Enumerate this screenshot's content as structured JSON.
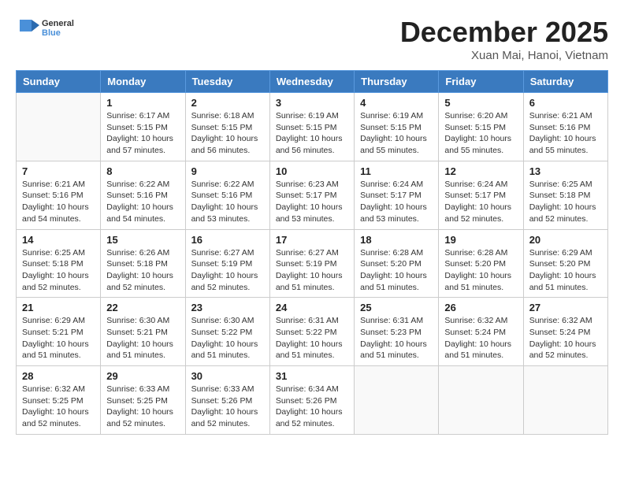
{
  "header": {
    "logo_general": "General",
    "logo_blue": "Blue",
    "month_year": "December 2025",
    "location": "Xuan Mai, Hanoi, Vietnam"
  },
  "weekdays": [
    "Sunday",
    "Monday",
    "Tuesday",
    "Wednesday",
    "Thursday",
    "Friday",
    "Saturday"
  ],
  "weeks": [
    [
      {
        "day": "",
        "info": ""
      },
      {
        "day": "1",
        "info": "Sunrise: 6:17 AM\nSunset: 5:15 PM\nDaylight: 10 hours\nand 57 minutes."
      },
      {
        "day": "2",
        "info": "Sunrise: 6:18 AM\nSunset: 5:15 PM\nDaylight: 10 hours\nand 56 minutes."
      },
      {
        "day": "3",
        "info": "Sunrise: 6:19 AM\nSunset: 5:15 PM\nDaylight: 10 hours\nand 56 minutes."
      },
      {
        "day": "4",
        "info": "Sunrise: 6:19 AM\nSunset: 5:15 PM\nDaylight: 10 hours\nand 55 minutes."
      },
      {
        "day": "5",
        "info": "Sunrise: 6:20 AM\nSunset: 5:15 PM\nDaylight: 10 hours\nand 55 minutes."
      },
      {
        "day": "6",
        "info": "Sunrise: 6:21 AM\nSunset: 5:16 PM\nDaylight: 10 hours\nand 55 minutes."
      }
    ],
    [
      {
        "day": "7",
        "info": "Sunrise: 6:21 AM\nSunset: 5:16 PM\nDaylight: 10 hours\nand 54 minutes."
      },
      {
        "day": "8",
        "info": "Sunrise: 6:22 AM\nSunset: 5:16 PM\nDaylight: 10 hours\nand 54 minutes."
      },
      {
        "day": "9",
        "info": "Sunrise: 6:22 AM\nSunset: 5:16 PM\nDaylight: 10 hours\nand 53 minutes."
      },
      {
        "day": "10",
        "info": "Sunrise: 6:23 AM\nSunset: 5:17 PM\nDaylight: 10 hours\nand 53 minutes."
      },
      {
        "day": "11",
        "info": "Sunrise: 6:24 AM\nSunset: 5:17 PM\nDaylight: 10 hours\nand 53 minutes."
      },
      {
        "day": "12",
        "info": "Sunrise: 6:24 AM\nSunset: 5:17 PM\nDaylight: 10 hours\nand 52 minutes."
      },
      {
        "day": "13",
        "info": "Sunrise: 6:25 AM\nSunset: 5:18 PM\nDaylight: 10 hours\nand 52 minutes."
      }
    ],
    [
      {
        "day": "14",
        "info": "Sunrise: 6:25 AM\nSunset: 5:18 PM\nDaylight: 10 hours\nand 52 minutes."
      },
      {
        "day": "15",
        "info": "Sunrise: 6:26 AM\nSunset: 5:18 PM\nDaylight: 10 hours\nand 52 minutes."
      },
      {
        "day": "16",
        "info": "Sunrise: 6:27 AM\nSunset: 5:19 PM\nDaylight: 10 hours\nand 52 minutes."
      },
      {
        "day": "17",
        "info": "Sunrise: 6:27 AM\nSunset: 5:19 PM\nDaylight: 10 hours\nand 51 minutes."
      },
      {
        "day": "18",
        "info": "Sunrise: 6:28 AM\nSunset: 5:20 PM\nDaylight: 10 hours\nand 51 minutes."
      },
      {
        "day": "19",
        "info": "Sunrise: 6:28 AM\nSunset: 5:20 PM\nDaylight: 10 hours\nand 51 minutes."
      },
      {
        "day": "20",
        "info": "Sunrise: 6:29 AM\nSunset: 5:20 PM\nDaylight: 10 hours\nand 51 minutes."
      }
    ],
    [
      {
        "day": "21",
        "info": "Sunrise: 6:29 AM\nSunset: 5:21 PM\nDaylight: 10 hours\nand 51 minutes."
      },
      {
        "day": "22",
        "info": "Sunrise: 6:30 AM\nSunset: 5:21 PM\nDaylight: 10 hours\nand 51 minutes."
      },
      {
        "day": "23",
        "info": "Sunrise: 6:30 AM\nSunset: 5:22 PM\nDaylight: 10 hours\nand 51 minutes."
      },
      {
        "day": "24",
        "info": "Sunrise: 6:31 AM\nSunset: 5:22 PM\nDaylight: 10 hours\nand 51 minutes."
      },
      {
        "day": "25",
        "info": "Sunrise: 6:31 AM\nSunset: 5:23 PM\nDaylight: 10 hours\nand 51 minutes."
      },
      {
        "day": "26",
        "info": "Sunrise: 6:32 AM\nSunset: 5:24 PM\nDaylight: 10 hours\nand 51 minutes."
      },
      {
        "day": "27",
        "info": "Sunrise: 6:32 AM\nSunset: 5:24 PM\nDaylight: 10 hours\nand 52 minutes."
      }
    ],
    [
      {
        "day": "28",
        "info": "Sunrise: 6:32 AM\nSunset: 5:25 PM\nDaylight: 10 hours\nand 52 minutes."
      },
      {
        "day": "29",
        "info": "Sunrise: 6:33 AM\nSunset: 5:25 PM\nDaylight: 10 hours\nand 52 minutes."
      },
      {
        "day": "30",
        "info": "Sunrise: 6:33 AM\nSunset: 5:26 PM\nDaylight: 10 hours\nand 52 minutes."
      },
      {
        "day": "31",
        "info": "Sunrise: 6:34 AM\nSunset: 5:26 PM\nDaylight: 10 hours\nand 52 minutes."
      },
      {
        "day": "",
        "info": ""
      },
      {
        "day": "",
        "info": ""
      },
      {
        "day": "",
        "info": ""
      }
    ]
  ]
}
